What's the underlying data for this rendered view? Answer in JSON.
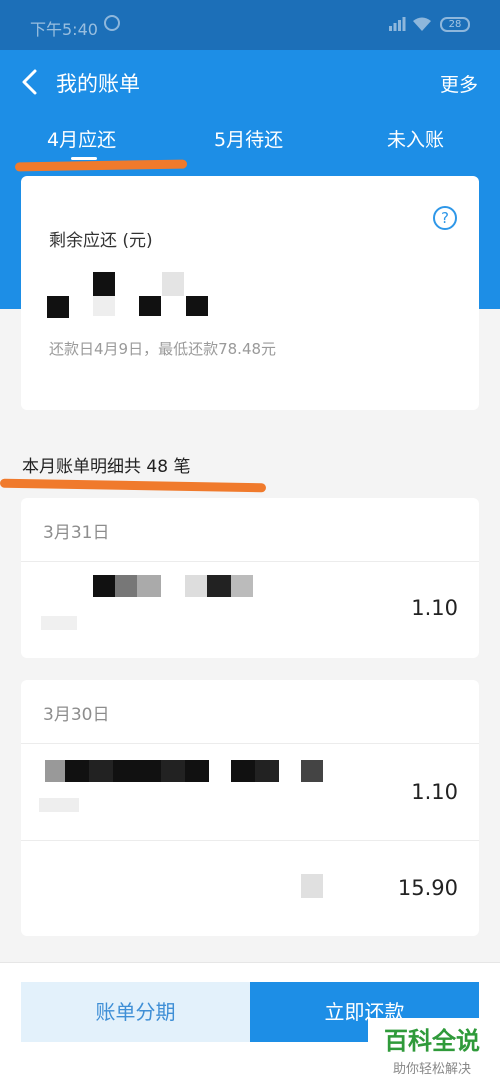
{
  "status_bar": {
    "time": "下午5:40",
    "battery": "28"
  },
  "header": {
    "title": "我的账单",
    "more": "更多"
  },
  "tabs": [
    {
      "label": "4月应还",
      "active": true
    },
    {
      "label": "5月待还",
      "active": false
    },
    {
      "label": "未入账",
      "active": false
    }
  ],
  "summary": {
    "remaining_label": "剩余应还 (元)",
    "due_info": "还款日4月9日，最低还款78.48元"
  },
  "detail_header": "本月账单明细共 48 笔",
  "days": [
    {
      "date": "3月31日",
      "amounts": [
        "1.10"
      ]
    },
    {
      "date": "3月30日",
      "amounts": [
        "1.10",
        "15.90"
      ]
    }
  ],
  "buttons": {
    "installment": "账单分期",
    "repay": "立即还款"
  },
  "watermark": {
    "main": "百科全说",
    "sub": "助你轻松解决"
  },
  "colors": {
    "primary": "#1d8ee6",
    "status_bar": "#1c6fb8",
    "annotation": "#f07a2c",
    "watermark": "#2f9a3a"
  }
}
